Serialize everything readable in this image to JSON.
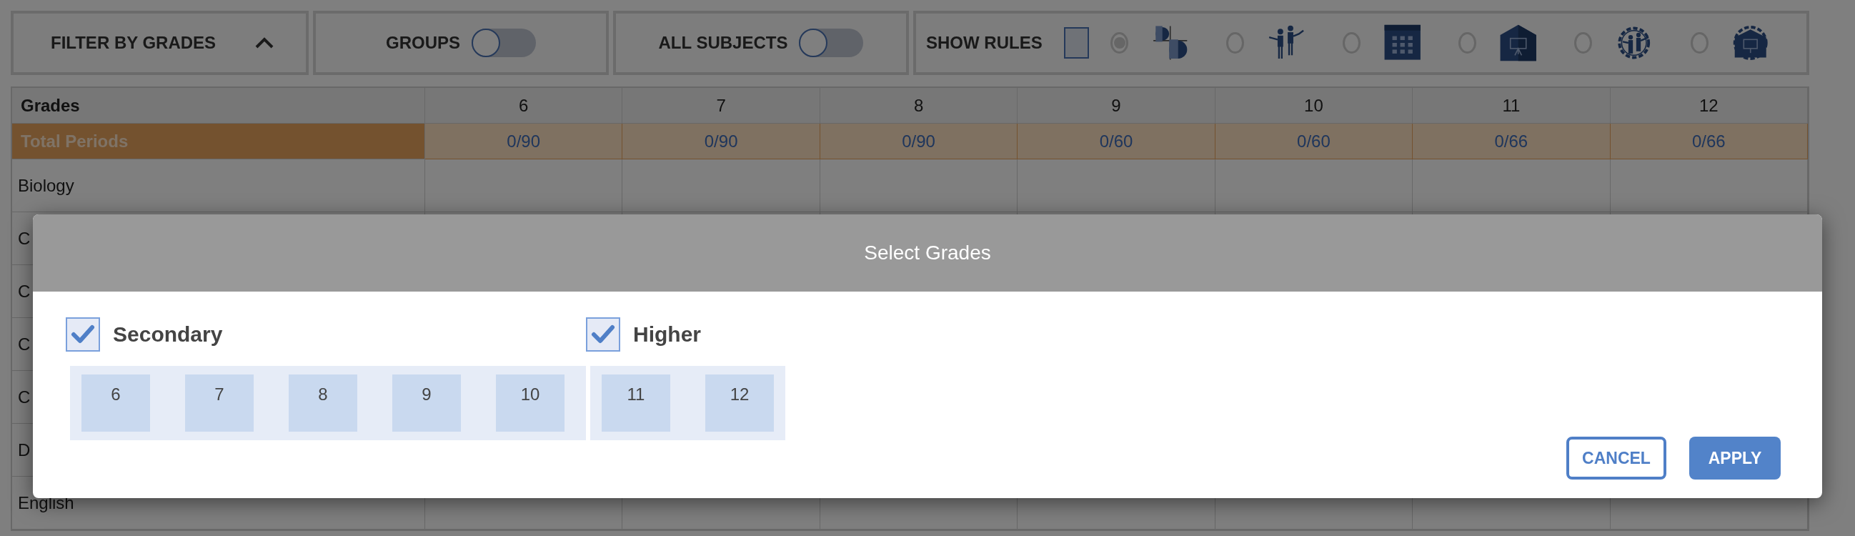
{
  "toolbar": {
    "filter": {
      "label": "FILTER BY GRADES",
      "expanded": true
    },
    "groups": {
      "label": "GROUPS",
      "on": false
    },
    "all_subjects": {
      "label": "ALL SUBJECTS",
      "on": false
    },
    "show_rules": {
      "label": "SHOW RULES",
      "checked": false,
      "options": [
        {
          "kind": "circles",
          "selected": true
        },
        {
          "kind": "people",
          "selected": false
        },
        {
          "kind": "calendar",
          "selected": false
        },
        {
          "kind": "classroom",
          "selected": false
        },
        {
          "kind": "gear-people",
          "selected": false
        },
        {
          "kind": "gear-classroom",
          "selected": false
        }
      ]
    }
  },
  "table": {
    "header": "Grades",
    "columns": [
      "6",
      "7",
      "8",
      "9",
      "10",
      "11",
      "12"
    ],
    "totals": {
      "label": "Total Periods",
      "values": [
        "0/90",
        "0/90",
        "0/90",
        "0/60",
        "0/60",
        "0/66",
        "0/66"
      ]
    },
    "rows": [
      {
        "name": "Biology"
      },
      {
        "name": "C"
      },
      {
        "name": "C"
      },
      {
        "name": "C"
      },
      {
        "name": "C"
      },
      {
        "name": "D"
      },
      {
        "name": "English"
      }
    ]
  },
  "dialog": {
    "title": "Select Grades",
    "groups": [
      {
        "label": "Secondary",
        "checked": true,
        "grades": [
          "6",
          "7",
          "8",
          "9",
          "10"
        ]
      },
      {
        "label": "Higher",
        "checked": true,
        "grades": [
          "11",
          "12"
        ]
      }
    ],
    "buttons": [
      {
        "label": "CANCEL",
        "kind": "outline"
      },
      {
        "label": "APPLY",
        "kind": "primary"
      }
    ]
  }
}
